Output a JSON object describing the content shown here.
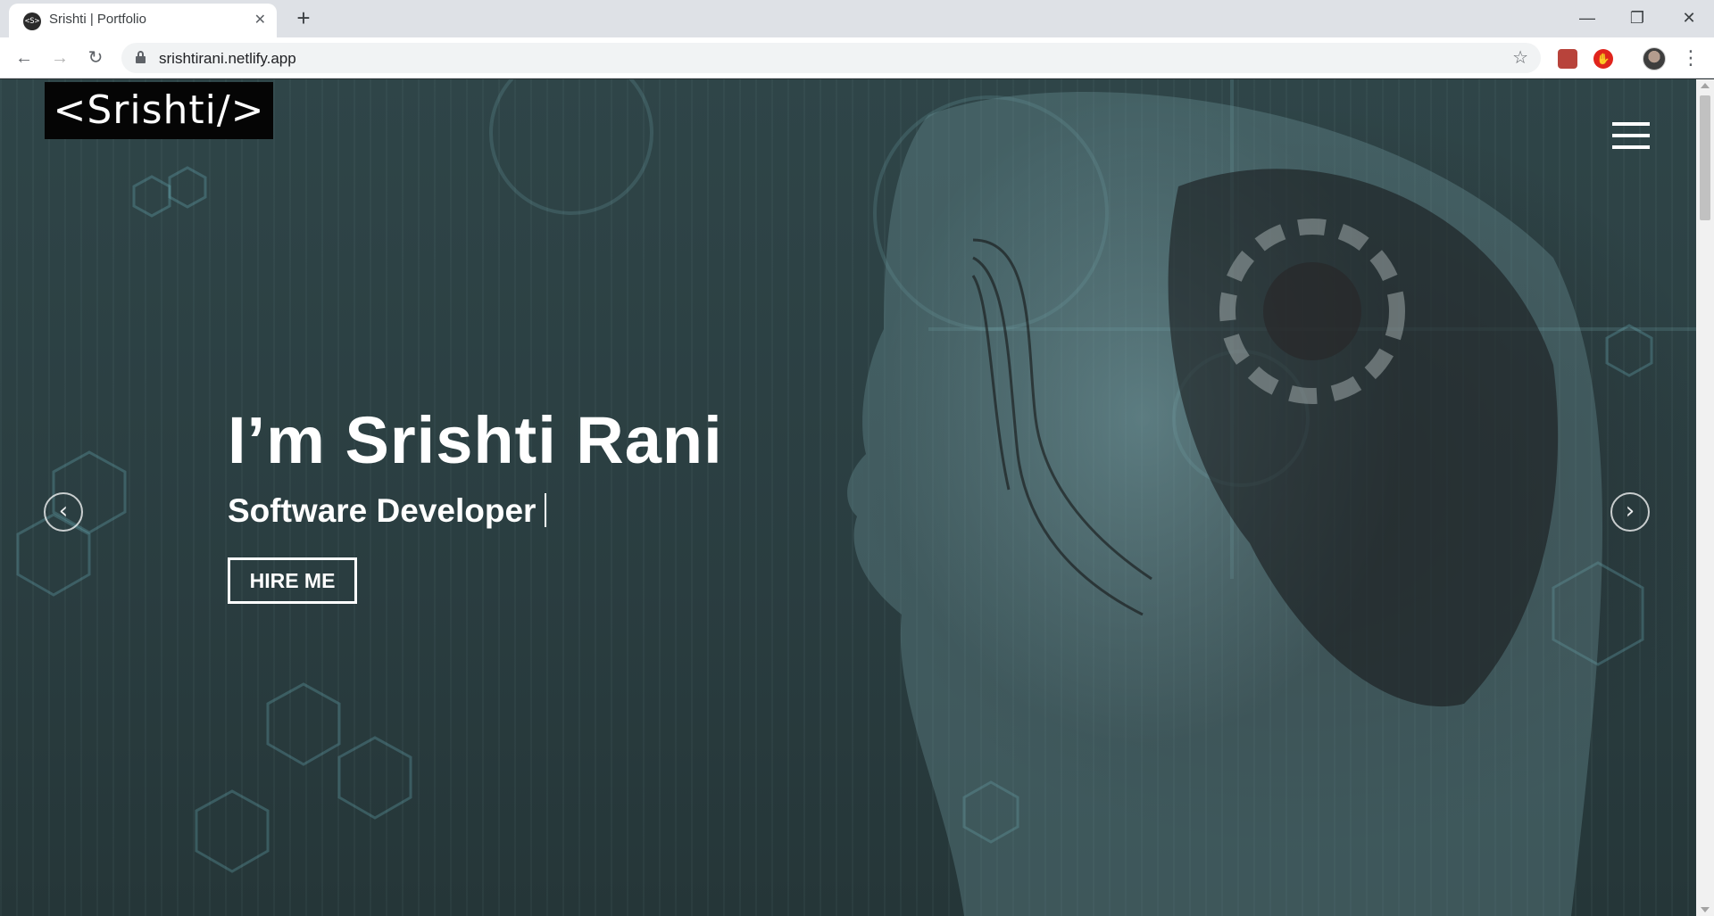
{
  "browser": {
    "tab_title": "Srishti | Portfolio",
    "tab_favicon": "<S>",
    "tab_close": "✕",
    "new_tab": "+",
    "url": "srishtirani.netlify.app",
    "window_controls": {
      "minimize": "—",
      "restore": "❐",
      "close": "✕"
    },
    "nav": {
      "back": "←",
      "forward": "→",
      "reload": "↻"
    },
    "star": "☆",
    "menu": "⋮",
    "extensions": [
      "pdf-icon",
      "adblock-icon"
    ]
  },
  "site": {
    "logo": "<Srishti/>",
    "hero": {
      "title": "I’m Srishti Rani",
      "subtitle": "Software Developer",
      "cta": "HIRE ME"
    },
    "carousel": {
      "prev": "‹",
      "next": "›"
    }
  },
  "colors": {
    "accent": "#ffffff",
    "hero_bg": "#2f4548",
    "logo_bg": "#050505"
  }
}
